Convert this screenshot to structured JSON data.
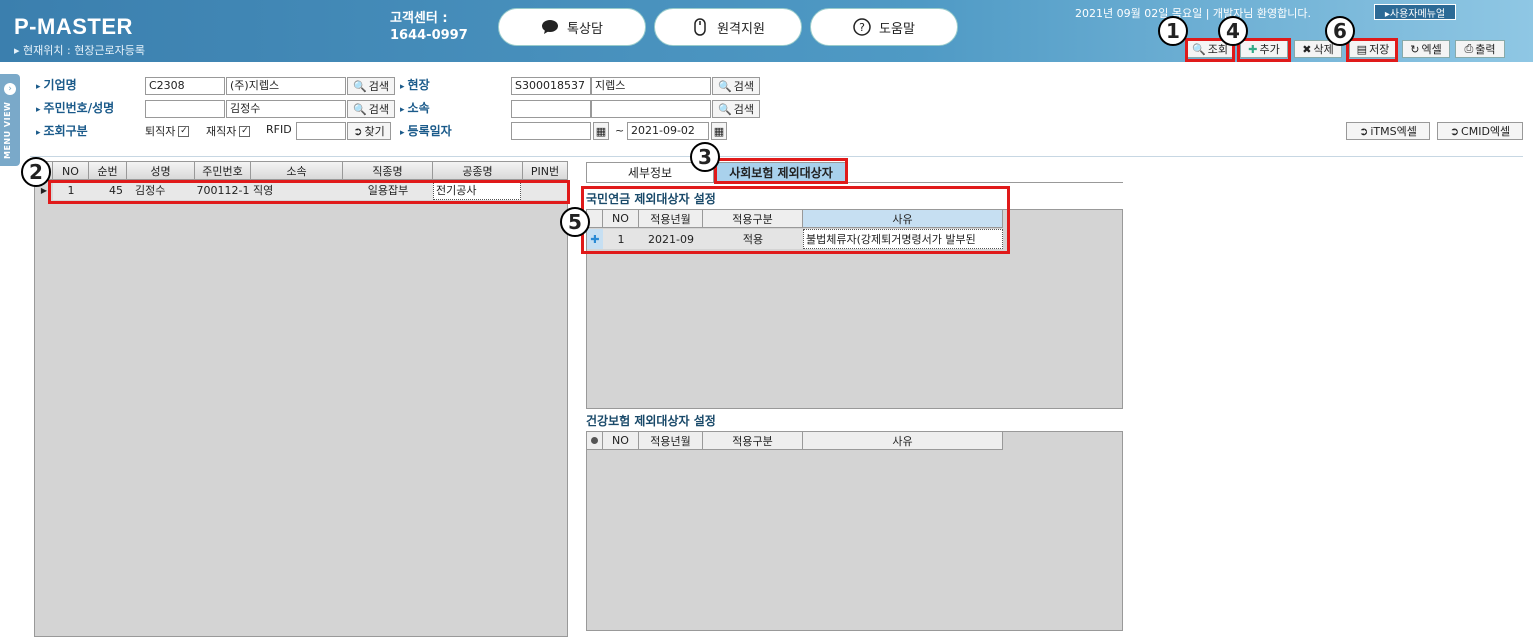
{
  "header": {
    "logo": "P-MASTER",
    "location": "▸ 현재위치 : 현장근로자등록",
    "center_label": "고객센터 :",
    "center_phone": "1644-0997",
    "pills": [
      "톡상담",
      "원격지원",
      "도움말"
    ],
    "welcome": "2021년 09월 02일 목요일 | 개발자님 환영합니다.",
    "user_menu": "▸사용자메뉴얼"
  },
  "toolbar": {
    "search": "조회",
    "add": "추가",
    "delete": "삭제",
    "save": "저장",
    "excel": "엑셀",
    "print": "출력"
  },
  "side": {
    "menu_view": "MENU VIEW"
  },
  "form": {
    "company_label": "기업명",
    "company_code": "C2308",
    "company_name": "(주)지렙스",
    "site_label": "현장",
    "site_code": "S300018537",
    "site_name": "지렙스",
    "resid_label": "주민번호/성명",
    "resid_value": "",
    "person_name": "김정수",
    "dept_label": "소속",
    "dept_code": "",
    "dept_name": "",
    "type_label": "조회구분",
    "retired_label": "퇴직자",
    "employed_label": "재직자",
    "rfid_label": "RFID",
    "rfid_value": "",
    "regdate_label": "등록일자",
    "date_from": "",
    "date_tilde": "~",
    "date_to": "2021-09-02",
    "search_btn": "검색",
    "find_btn": "찾기",
    "itms_btn": "iTMS엑셀",
    "cmid_btn": "CMID엑셀"
  },
  "left_grid": {
    "columns": [
      "NO",
      "순번",
      "성명",
      "주민번호",
      "소속",
      "직종명",
      "공종명",
      "PIN번"
    ],
    "rows": [
      [
        "1",
        "45",
        "김정수",
        "700112-1",
        "직영",
        "일용잡부",
        "전기공사",
        ""
      ]
    ]
  },
  "tabs": [
    "세부정보",
    "사회보험 제외대상자"
  ],
  "pension": {
    "title": "국민연금 제외대상자 설정",
    "columns": [
      "NO",
      "적용년월",
      "적용구분",
      "사유"
    ],
    "rows": [
      [
        "1",
        "2021-09",
        "적용",
        "불법체류자(강제퇴거명령서가 발부된"
      ]
    ]
  },
  "health": {
    "title": "건강보험 제외대상자 설정",
    "columns": [
      "NO",
      "적용년월",
      "적용구분",
      "사유"
    ],
    "rows": []
  },
  "badges": [
    "1",
    "2",
    "3",
    "4",
    "5",
    "6"
  ]
}
